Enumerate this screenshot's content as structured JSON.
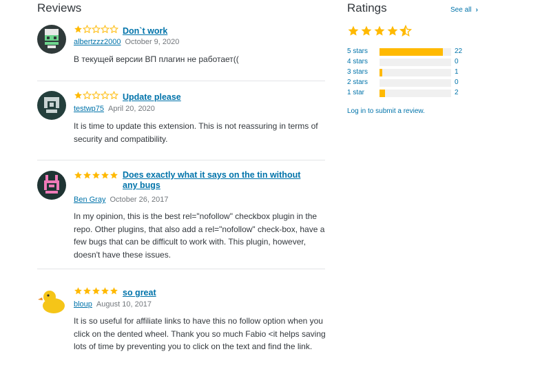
{
  "reviews_section": {
    "heading": "Reviews"
  },
  "ratings_section": {
    "heading": "Ratings",
    "see_all": "See all",
    "average_stars": 4.5,
    "rows": [
      {
        "label": "5 stars",
        "count": "22",
        "fraction": 0.88
      },
      {
        "label": "4 stars",
        "count": "0",
        "fraction": 0
      },
      {
        "label": "3 stars",
        "count": "1",
        "fraction": 0.04
      },
      {
        "label": "2 stars",
        "count": "0",
        "fraction": 0
      },
      {
        "label": "1 star",
        "count": "2",
        "fraction": 0.08
      }
    ],
    "login_link": "Log in to submit a review."
  },
  "reviews": [
    {
      "title": "Don`t work",
      "rating": 1,
      "author": "albertzzz2000",
      "date": "October 9, 2020",
      "body": "В текущей версии ВП плагин не работает(("
    },
    {
      "title": "Update please",
      "rating": 1,
      "author": "testwp75",
      "date": "April 20, 2020",
      "body": "It is time to update this extension. This is not reassuring in terms of security and compatibility."
    },
    {
      "title": "Does exactly what it says on the tin without any bugs",
      "rating": 5,
      "author": "Ben Gray",
      "date": "October 26, 2017",
      "body": "In my opinion, this is the best rel=\"nofollow\" checkbox plugin in the repo. Other plugins, that also add a rel=\"nofollow\" check-box, have a few bugs that can be difficult to work with. This plugin, however, doesn't have these issues."
    },
    {
      "title": "so great",
      "rating": 5,
      "author": "bloup",
      "date": "August 10, 2017",
      "body": "It is so useful for affiliate links to have this no follow option when you click on the dented wheel. Thank you so much Fabio <it helps saving lots of time by preventing you to click on the text and find the link."
    }
  ],
  "colors": {
    "accent": "#0073aa",
    "star": "#ffb900",
    "text": "#32373c",
    "muted": "#72777c"
  },
  "icons": {
    "star_full": "star-icon",
    "star_empty": "star-empty-icon",
    "star_half": "star-half-icon",
    "chevron": "chevron-right-icon"
  }
}
